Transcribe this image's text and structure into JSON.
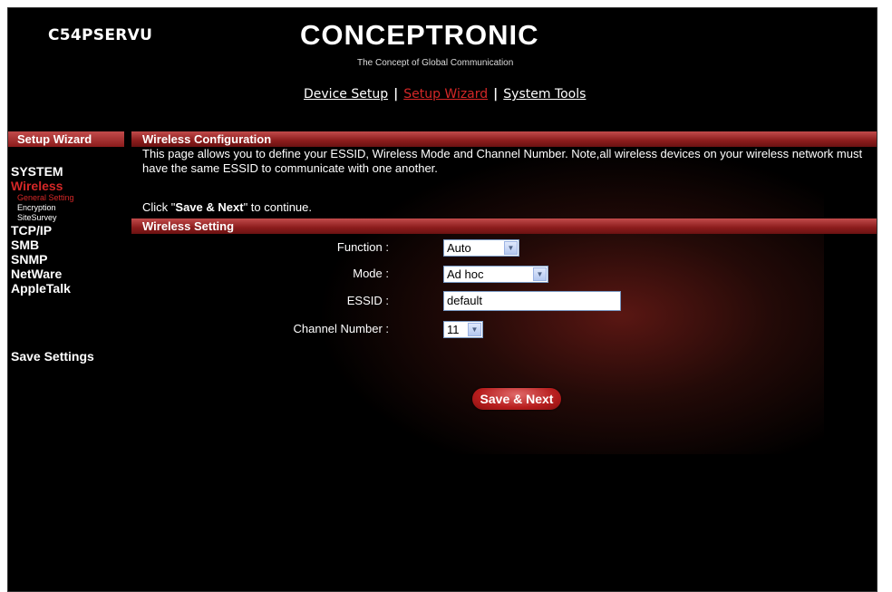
{
  "header": {
    "model": "C54PSERVU",
    "logo": "CONCEPTRONIC",
    "tagline": "The Concept of Global Communication"
  },
  "topnav": {
    "items": [
      "Device Setup",
      "Setup Wizard",
      "System Tools"
    ],
    "separator": "|",
    "active": "Setup Wizard"
  },
  "sidebar": {
    "title": "Setup Wizard",
    "system": "SYSTEM",
    "wireless": "Wireless",
    "sub": [
      "General Setting",
      "Encryption",
      "SiteSurvey"
    ],
    "tcpip": "TCP/IP",
    "smb": "SMB",
    "snmp": "SNMP",
    "netware": "NetWare",
    "appletalk": "AppleTalk",
    "save": "Save Settings"
  },
  "main": {
    "section1_title": "Wireless Configuration",
    "description": "This page allows you to define your ESSID, Wireless Mode and Channel Number. Note,all wireless devices on your wireless network must have the same ESSID to communicate with one another.",
    "continue_prefix": "Click \"",
    "continue_bold": "Save & Next",
    "continue_suffix": "\" to continue.",
    "section2_title": "Wireless Setting"
  },
  "form": {
    "function_label": "Function :",
    "function_value": "Auto",
    "mode_label": "Mode :",
    "mode_value": "Ad hoc",
    "essid_label": "ESSID :",
    "essid_value": "default",
    "channel_label": "Channel Number :",
    "channel_value": "11"
  },
  "buttons": {
    "save_next": "Save & Next"
  },
  "colors": {
    "accent": "#d42727",
    "bar": "#9b2a2a",
    "background": "#000000"
  }
}
